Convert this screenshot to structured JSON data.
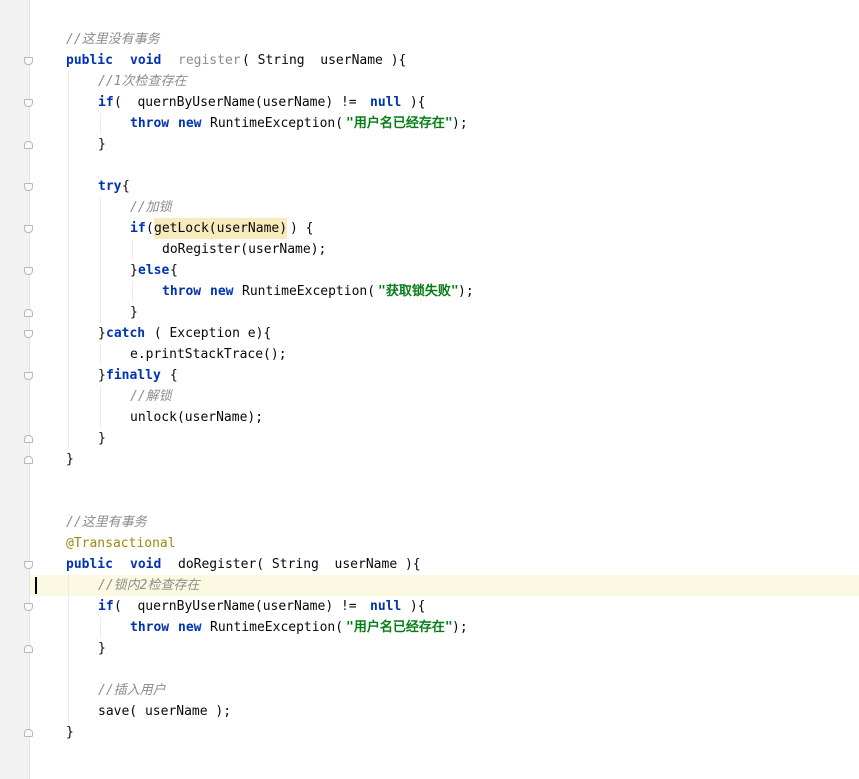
{
  "editor": {
    "highlight_color": "#fcf9e3",
    "keyword_color": "#0033b3",
    "string_color": "#067d17",
    "comment_color": "#8c8c8c",
    "annotation_color": "#9e880d"
  },
  "code": {
    "l01": "//这里没有事务",
    "l02_kw1": "public",
    "l02_kw2": "void",
    "l02_name": "register",
    "l02_rest": "( String  userName ){",
    "l03": "//1次检查存在",
    "l04_kw": "if",
    "l04_mid": "(  quernByUserName(userName) != ",
    "l04_null": "null",
    "l04_end": " ){",
    "l05_kw1": "throw",
    "l05_kw2": "new",
    "l05_mid": "RuntimeException(",
    "l05_str": "\"用户名已经存在\"",
    "l05_end": ");",
    "l06": "}",
    "l08_kw": "try",
    "l08_end": "{",
    "l09": "//加锁",
    "l10_kw": "if",
    "l10_paren": "(",
    "l10_hl": "getLock(userName)",
    "l10_end": ") {",
    "l11": "doRegister(userName);",
    "l12_brace": "}",
    "l12_kw": "else",
    "l12_end": "{",
    "l13_kw1": "throw",
    "l13_kw2": "new",
    "l13_mid": "RuntimeException(",
    "l13_str": "\"获取锁失败\"",
    "l13_end": ");",
    "l14": "}",
    "l15_brace": "}",
    "l15_kw": "catch",
    "l15_end": " ( Exception e){",
    "l16": "e.printStackTrace();",
    "l17_brace": "}",
    "l17_kw": "finally",
    "l17_end": " {",
    "l18": "//解锁",
    "l19": "unlock(userName);",
    "l20": "}",
    "l21": "}",
    "l24": "//这里有事务",
    "l25": "@Transactional",
    "l26_kw1": "public",
    "l26_kw2": "void",
    "l26_rest": "doRegister( String  userName ){",
    "l27": "//锁内2检查存在",
    "l28_kw": "if",
    "l28_mid": "(  quernByUserName(userName) != ",
    "l28_null": "null",
    "l28_end": " ){",
    "l29_kw1": "throw",
    "l29_kw2": "new",
    "l29_mid": "RuntimeException(",
    "l29_str": "\"用户名已经存在\"",
    "l29_end": ");",
    "l30": "}",
    "l32": "//插入用户",
    "l33": "save( userName );",
    "l34": "}"
  }
}
